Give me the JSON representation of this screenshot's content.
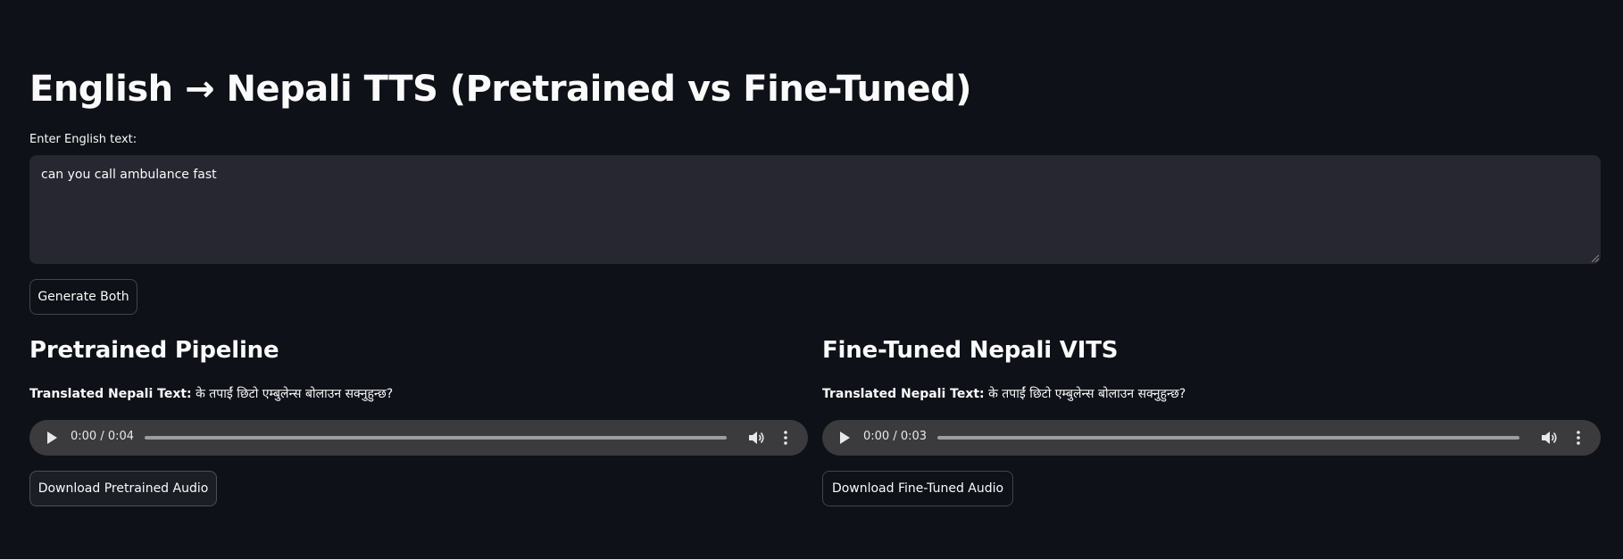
{
  "header": {
    "title": "English → Nepali TTS (Pretrained vs Fine-Tuned)"
  },
  "input": {
    "label": "Enter English text:",
    "value": "can you call ambulance fast"
  },
  "actions": {
    "generate_label": "Generate Both"
  },
  "pretrained": {
    "heading": "Pretrained Pipeline",
    "translated_label": "Translated Nepali Text:",
    "translated_value": "के तपाईं छिटो एम्बुलेन्स बोलाउन सक्नुहुन्छ?",
    "audio_time": "0:00 / 0:04",
    "download_label": "Download Pretrained Audio"
  },
  "finetuned": {
    "heading": "Fine-Tuned Nepali VITS",
    "translated_label": "Translated Nepali Text:",
    "translated_value": "के तपाईं छिटो एम्बुलेन्स बोलाउन सक्नुहुन्छ?",
    "audio_time": "0:00 / 0:03",
    "download_label": "Download Fine-Tuned Audio"
  },
  "icons": {
    "play": "play-icon",
    "volume": "volume-icon",
    "more": "more-vertical-icon",
    "resize": "resize-grip-icon"
  },
  "colors": {
    "background": "#0e1117",
    "input_background": "#262730",
    "audio_background": "#3b3b3d",
    "text": "#fafafa"
  }
}
